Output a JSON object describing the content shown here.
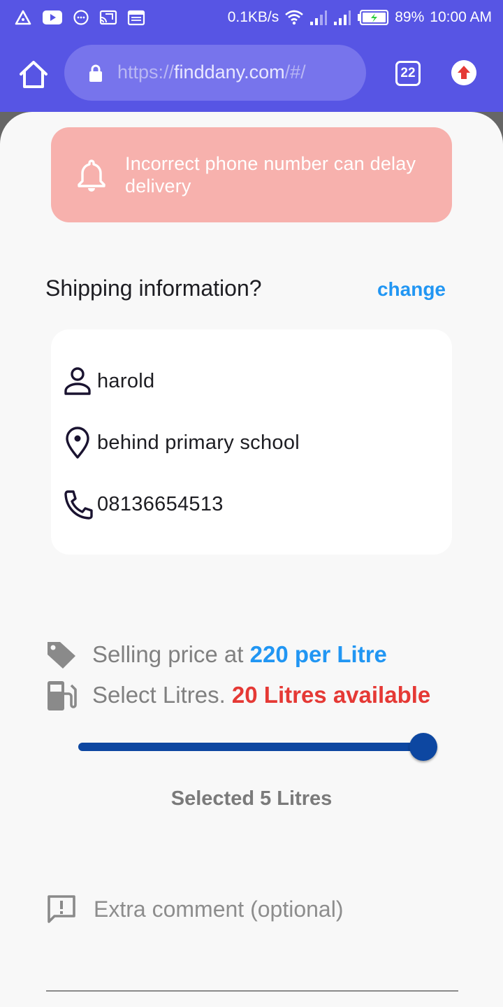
{
  "status_bar": {
    "net_speed": "0.1KB/s",
    "battery": "89%",
    "time": "10:00 AM",
    "icons": [
      "alert-triangle-icon",
      "youtube-icon",
      "messenger-icon",
      "cast-icon",
      "calendar-icon",
      "wifi-icon",
      "signal-icon",
      "signal-icon",
      "battery-charging-icon"
    ]
  },
  "browser": {
    "url_scheme": "https://",
    "url_host": "finddany.com",
    "url_path": "/#/",
    "tab_count": "22",
    "icons": [
      "home-icon",
      "lock-icon",
      "tabs-icon",
      "upgrade-arrow-icon"
    ]
  },
  "alert": {
    "text": "Incorrect phone number can delay delivery",
    "icon": "bell-icon"
  },
  "shipping": {
    "title": "Shipping information?",
    "change_label": "change",
    "name": "harold",
    "address": "behind primary school",
    "phone": "08136654513"
  },
  "pricing": {
    "price_prefix": "Selling price at ",
    "price_value": "220 per Litre",
    "litres_prefix": "Select Litres. ",
    "litres_available": "20 Litres available"
  },
  "slider": {
    "value_fraction": 1.0
  },
  "selection": {
    "text": "Selected 5 Litres"
  },
  "comment": {
    "placeholder": "Extra comment (optional)"
  },
  "colors": {
    "primary": "#5755e4",
    "link_blue": "#2196f3",
    "alert_bg": "#f7b1ad",
    "warning_red": "#e53935",
    "slider_blue": "#0d47a1"
  }
}
